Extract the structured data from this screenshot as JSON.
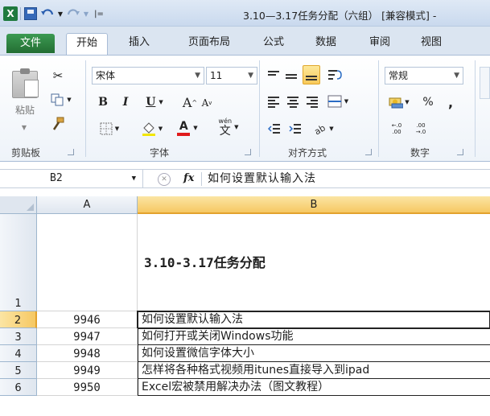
{
  "window": {
    "title": "3.10—3.17任务分配（六组） [兼容模式] -"
  },
  "quick_access": {
    "app_icon": "excel-logo-icon",
    "app_letter": "X",
    "save_icon": "save-icon",
    "undo_icon": "undo-icon",
    "redo_icon": "redo-icon",
    "customize_icon": "customize-qat-icon"
  },
  "tabs": [
    {
      "label": "文件"
    },
    {
      "label": "开始"
    },
    {
      "label": "插入"
    },
    {
      "label": "页面布局"
    },
    {
      "label": "公式"
    },
    {
      "label": "数据"
    },
    {
      "label": "审阅"
    },
    {
      "label": "视图"
    }
  ],
  "ribbon": {
    "clipboard": {
      "paste_label": "粘贴",
      "group_label": "剪贴板"
    },
    "font": {
      "font_name": "宋体",
      "font_size": "11",
      "bold": "B",
      "italic": "I",
      "underline": "U",
      "grow": "A",
      "shrink": "A",
      "font_color": "A",
      "phonetic": "wén",
      "phonetic_char": "文",
      "group_label": "字体"
    },
    "alignment": {
      "group_label": "对齐方式"
    },
    "number": {
      "format": "常规",
      "percent": "%",
      "comma": ",",
      "increase_decimal": "←.0 .00",
      "decrease_decimal": ".00 →.0",
      "group_label": "数字"
    }
  },
  "formula_bar": {
    "name_box": "B2",
    "fx": "fx",
    "content": "如何设置默认输入法"
  },
  "sheet": {
    "columns": [
      "A",
      "B"
    ],
    "rows": [
      {
        "num": "1",
        "a": "",
        "b": "3.10-3.17任务分配"
      },
      {
        "num": "2",
        "a": "9946",
        "b": "如何设置默认输入法"
      },
      {
        "num": "3",
        "a": "9947",
        "b": "如何打开或关闭Windows功能"
      },
      {
        "num": "4",
        "a": "9948",
        "b": "如何设置微信字体大小"
      },
      {
        "num": "5",
        "a": "9949",
        "b": "怎样将各种格式视频用itunes直接导入到ipad"
      },
      {
        "num": "6",
        "a": "9950",
        "b": "Excel宏被禁用解决办法（图文教程）"
      }
    ]
  },
  "colors": {
    "selection_header": "#f6c863",
    "file_tab": "#236e33",
    "excel_green": "#1f7a3f"
  }
}
